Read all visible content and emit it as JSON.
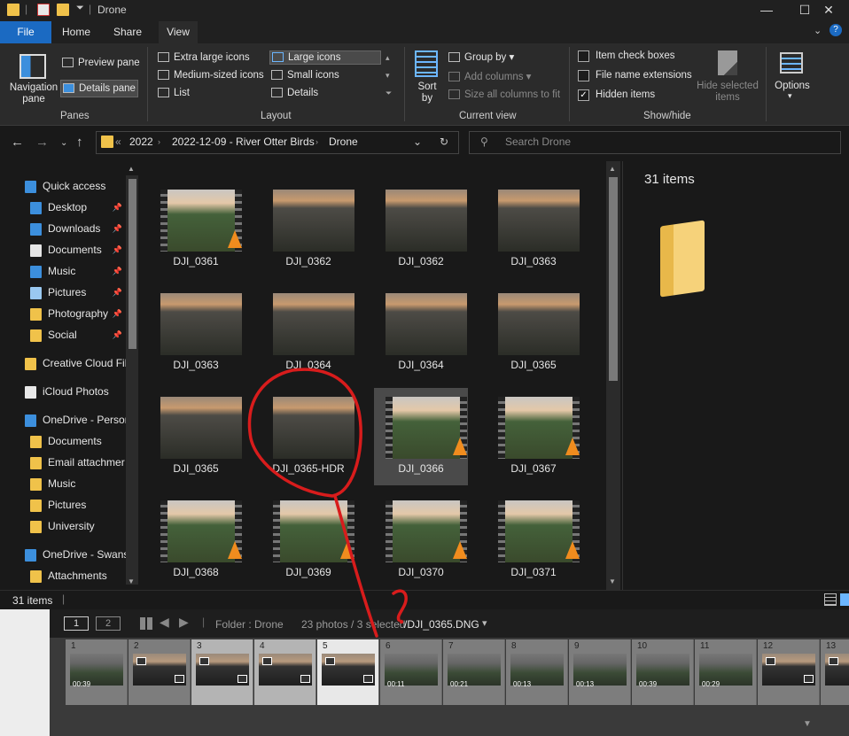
{
  "window": {
    "title": "Drone",
    "minimize": "—",
    "maximize": "☐",
    "close": "✕"
  },
  "tabs": [
    "File",
    "Home",
    "Share",
    "View"
  ],
  "ribbon": {
    "panes": {
      "navigation_pane": "Navigation pane",
      "preview_pane": "Preview pane",
      "details_pane": "Details pane",
      "group": "Panes"
    },
    "layout": {
      "extra_large": "Extra large icons",
      "large": "Large icons",
      "medium": "Medium-sized icons",
      "small": "Small icons",
      "list": "List",
      "details": "Details",
      "group": "Layout"
    },
    "current_view": {
      "sort_by": "Sort by",
      "group_by": "Group by",
      "add_columns": "Add columns",
      "size_columns": "Size all columns to fit",
      "group": "Current view"
    },
    "show_hide": {
      "item_check_boxes": "Item check boxes",
      "file_name_extensions": "File name extensions",
      "hidden_items": "Hidden items",
      "hide_selected": "Hide selected items",
      "group": "Show/hide"
    },
    "options": "Options"
  },
  "address": {
    "crumbs": [
      "2022",
      "2022-12-09 - River Otter Birds",
      "Drone"
    ],
    "overflow": "«"
  },
  "search": {
    "placeholder": "Search Drone"
  },
  "nav": [
    {
      "label": "Quick access",
      "pinned": false
    },
    {
      "label": "Desktop",
      "pinned": true
    },
    {
      "label": "Downloads",
      "pinned": true
    },
    {
      "label": "Documents",
      "pinned": true
    },
    {
      "label": "Music",
      "pinned": true
    },
    {
      "label": "Pictures",
      "pinned": true
    },
    {
      "label": "Photography",
      "pinned": true
    },
    {
      "label": "Social",
      "pinned": true
    },
    {
      "label": "Creative Cloud Fil",
      "pinned": false
    },
    {
      "label": "iCloud Photos",
      "pinned": false
    },
    {
      "label": "OneDrive - Persor",
      "pinned": false
    },
    {
      "label": "Documents",
      "pinned": false
    },
    {
      "label": "Email attachmer",
      "pinned": false
    },
    {
      "label": "Music",
      "pinned": false
    },
    {
      "label": "Pictures",
      "pinned": false
    },
    {
      "label": "University",
      "pinned": false
    },
    {
      "label": "OneDrive - Swans",
      "pinned": false
    },
    {
      "label": "Attachments",
      "pinned": false
    }
  ],
  "files": [
    {
      "name": "DJI_0361",
      "video": true
    },
    {
      "name": "DJI_0362",
      "video": false
    },
    {
      "name": "DJI_0362",
      "video": false
    },
    {
      "name": "DJI_0363",
      "video": false
    },
    {
      "name": "DJI_0363",
      "video": false
    },
    {
      "name": "DJI_0364",
      "video": false
    },
    {
      "name": "DJI_0364",
      "video": false
    },
    {
      "name": "DJI_0365",
      "video": false
    },
    {
      "name": "DJI_0365",
      "video": false
    },
    {
      "name": "DJI_0365-HDR",
      "video": false
    },
    {
      "name": "DJI_0366",
      "video": true,
      "selected": true
    },
    {
      "name": "DJI_0367",
      "video": true
    },
    {
      "name": "DJI_0368",
      "video": true
    },
    {
      "name": "DJI_0369",
      "video": true
    },
    {
      "name": "DJI_0370",
      "video": true
    },
    {
      "name": "DJI_0371",
      "video": true
    }
  ],
  "details_pane": {
    "count": "31 items"
  },
  "status": {
    "count": "31 items"
  },
  "filmstrip_header": {
    "view1": "1",
    "view2": "2",
    "folder": "Folder : Drone",
    "summary": "23 photos / 3 selected",
    "filename": "/DJI_0365.DNG",
    "dropdown": "▾"
  },
  "filmstrip": [
    {
      "num": "1",
      "dur": "00:39",
      "style": "normal",
      "badges": false
    },
    {
      "num": "2",
      "dur": "",
      "style": "normal",
      "badges": true
    },
    {
      "num": "3",
      "dur": "",
      "style": "hl",
      "badges": true
    },
    {
      "num": "4",
      "dur": "",
      "style": "hl",
      "badges": true
    },
    {
      "num": "5",
      "dur": "",
      "style": "cur",
      "badges": true
    },
    {
      "num": "6",
      "dur": "00:11",
      "style": "normal",
      "badges": false
    },
    {
      "num": "7",
      "dur": "00:21",
      "style": "normal",
      "badges": false
    },
    {
      "num": "8",
      "dur": "00:13",
      "style": "normal",
      "badges": false
    },
    {
      "num": "9",
      "dur": "00:13",
      "style": "normal",
      "badges": false
    },
    {
      "num": "10",
      "dur": "00:39",
      "style": "normal",
      "badges": false
    },
    {
      "num": "11",
      "dur": "00:29",
      "style": "normal",
      "badges": false
    },
    {
      "num": "12",
      "dur": "",
      "style": "normal",
      "badges": true
    },
    {
      "num": "13",
      "dur": "",
      "style": "normal",
      "badges": true
    }
  ],
  "annotation": {
    "color": "#d81c1c",
    "mark": "?"
  }
}
